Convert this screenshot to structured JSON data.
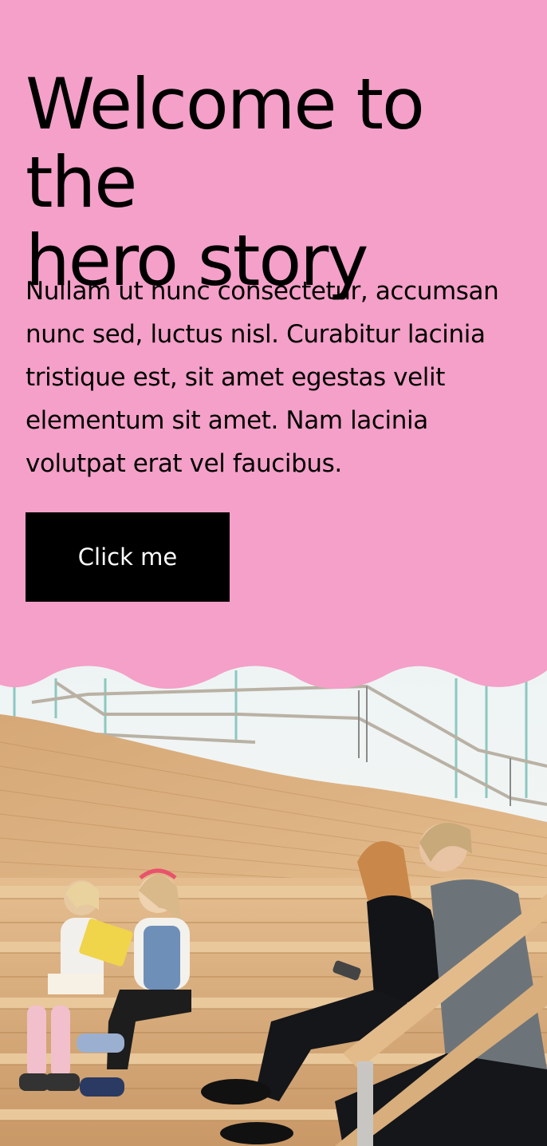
{
  "hero": {
    "title_line1": "Welcome to the",
    "title_line2": "hero story",
    "body": "Nullam ut nunc consectetur, accumsan nunc sed, luctus nisl. Curabitur lacinia tristique est, sit amet egestas velit elementum sit amet. Nam lacinia volutpat erat vel faucibus.",
    "button_label": "Click me"
  },
  "colors": {
    "background": "#f4a0c8",
    "button_bg": "#000000",
    "button_text": "#ffffff",
    "wood": "#d8a874"
  },
  "image": {
    "subject": "children and young adults sitting and reading on wooden library steps"
  }
}
